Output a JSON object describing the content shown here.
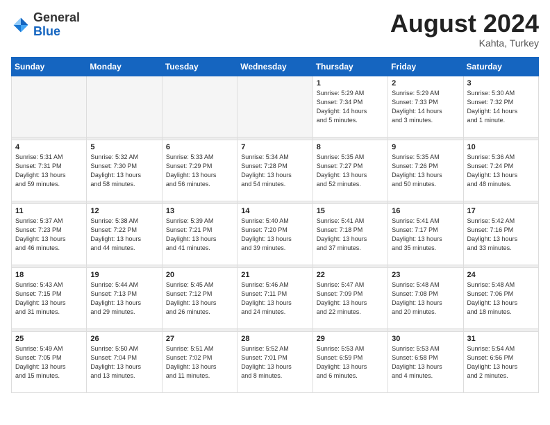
{
  "header": {
    "logo_general": "General",
    "logo_blue": "Blue",
    "month_year": "August 2024",
    "location": "Kahta, Turkey"
  },
  "days_of_week": [
    "Sunday",
    "Monday",
    "Tuesday",
    "Wednesday",
    "Thursday",
    "Friday",
    "Saturday"
  ],
  "weeks": [
    [
      {
        "day": "",
        "info": ""
      },
      {
        "day": "",
        "info": ""
      },
      {
        "day": "",
        "info": ""
      },
      {
        "day": "",
        "info": ""
      },
      {
        "day": "1",
        "info": "Sunrise: 5:29 AM\nSunset: 7:34 PM\nDaylight: 14 hours\nand 5 minutes."
      },
      {
        "day": "2",
        "info": "Sunrise: 5:29 AM\nSunset: 7:33 PM\nDaylight: 14 hours\nand 3 minutes."
      },
      {
        "day": "3",
        "info": "Sunrise: 5:30 AM\nSunset: 7:32 PM\nDaylight: 14 hours\nand 1 minute."
      }
    ],
    [
      {
        "day": "4",
        "info": "Sunrise: 5:31 AM\nSunset: 7:31 PM\nDaylight: 13 hours\nand 59 minutes."
      },
      {
        "day": "5",
        "info": "Sunrise: 5:32 AM\nSunset: 7:30 PM\nDaylight: 13 hours\nand 58 minutes."
      },
      {
        "day": "6",
        "info": "Sunrise: 5:33 AM\nSunset: 7:29 PM\nDaylight: 13 hours\nand 56 minutes."
      },
      {
        "day": "7",
        "info": "Sunrise: 5:34 AM\nSunset: 7:28 PM\nDaylight: 13 hours\nand 54 minutes."
      },
      {
        "day": "8",
        "info": "Sunrise: 5:35 AM\nSunset: 7:27 PM\nDaylight: 13 hours\nand 52 minutes."
      },
      {
        "day": "9",
        "info": "Sunrise: 5:35 AM\nSunset: 7:26 PM\nDaylight: 13 hours\nand 50 minutes."
      },
      {
        "day": "10",
        "info": "Sunrise: 5:36 AM\nSunset: 7:24 PM\nDaylight: 13 hours\nand 48 minutes."
      }
    ],
    [
      {
        "day": "11",
        "info": "Sunrise: 5:37 AM\nSunset: 7:23 PM\nDaylight: 13 hours\nand 46 minutes."
      },
      {
        "day": "12",
        "info": "Sunrise: 5:38 AM\nSunset: 7:22 PM\nDaylight: 13 hours\nand 44 minutes."
      },
      {
        "day": "13",
        "info": "Sunrise: 5:39 AM\nSunset: 7:21 PM\nDaylight: 13 hours\nand 41 minutes."
      },
      {
        "day": "14",
        "info": "Sunrise: 5:40 AM\nSunset: 7:20 PM\nDaylight: 13 hours\nand 39 minutes."
      },
      {
        "day": "15",
        "info": "Sunrise: 5:41 AM\nSunset: 7:18 PM\nDaylight: 13 hours\nand 37 minutes."
      },
      {
        "day": "16",
        "info": "Sunrise: 5:41 AM\nSunset: 7:17 PM\nDaylight: 13 hours\nand 35 minutes."
      },
      {
        "day": "17",
        "info": "Sunrise: 5:42 AM\nSunset: 7:16 PM\nDaylight: 13 hours\nand 33 minutes."
      }
    ],
    [
      {
        "day": "18",
        "info": "Sunrise: 5:43 AM\nSunset: 7:15 PM\nDaylight: 13 hours\nand 31 minutes."
      },
      {
        "day": "19",
        "info": "Sunrise: 5:44 AM\nSunset: 7:13 PM\nDaylight: 13 hours\nand 29 minutes."
      },
      {
        "day": "20",
        "info": "Sunrise: 5:45 AM\nSunset: 7:12 PM\nDaylight: 13 hours\nand 26 minutes."
      },
      {
        "day": "21",
        "info": "Sunrise: 5:46 AM\nSunset: 7:11 PM\nDaylight: 13 hours\nand 24 minutes."
      },
      {
        "day": "22",
        "info": "Sunrise: 5:47 AM\nSunset: 7:09 PM\nDaylight: 13 hours\nand 22 minutes."
      },
      {
        "day": "23",
        "info": "Sunrise: 5:48 AM\nSunset: 7:08 PM\nDaylight: 13 hours\nand 20 minutes."
      },
      {
        "day": "24",
        "info": "Sunrise: 5:48 AM\nSunset: 7:06 PM\nDaylight: 13 hours\nand 18 minutes."
      }
    ],
    [
      {
        "day": "25",
        "info": "Sunrise: 5:49 AM\nSunset: 7:05 PM\nDaylight: 13 hours\nand 15 minutes."
      },
      {
        "day": "26",
        "info": "Sunrise: 5:50 AM\nSunset: 7:04 PM\nDaylight: 13 hours\nand 13 minutes."
      },
      {
        "day": "27",
        "info": "Sunrise: 5:51 AM\nSunset: 7:02 PM\nDaylight: 13 hours\nand 11 minutes."
      },
      {
        "day": "28",
        "info": "Sunrise: 5:52 AM\nSunset: 7:01 PM\nDaylight: 13 hours\nand 8 minutes."
      },
      {
        "day": "29",
        "info": "Sunrise: 5:53 AM\nSunset: 6:59 PM\nDaylight: 13 hours\nand 6 minutes."
      },
      {
        "day": "30",
        "info": "Sunrise: 5:53 AM\nSunset: 6:58 PM\nDaylight: 13 hours\nand 4 minutes."
      },
      {
        "day": "31",
        "info": "Sunrise: 5:54 AM\nSunset: 6:56 PM\nDaylight: 13 hours\nand 2 minutes."
      }
    ]
  ]
}
